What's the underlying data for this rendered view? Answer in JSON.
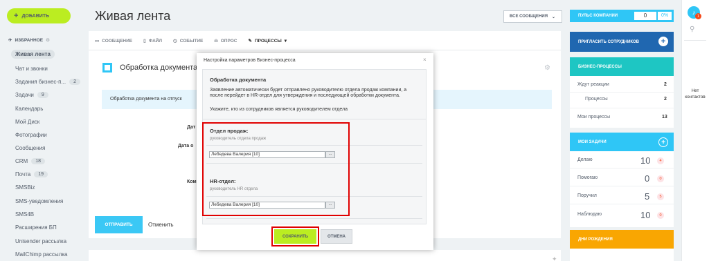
{
  "left": {
    "add_button": "ДОБАВИТЬ",
    "favorites": "ИЗБРАННОЕ",
    "items": [
      {
        "label": "Живая лента"
      },
      {
        "label": "Чат и звонки"
      },
      {
        "label": "Задания бизнес-п...",
        "count": "2"
      },
      {
        "label": "Задачи",
        "count": "9"
      },
      {
        "label": "Календарь"
      },
      {
        "label": "Мой Диск"
      },
      {
        "label": "Фотографии"
      },
      {
        "label": "Сообщения"
      },
      {
        "label": "CRM",
        "count": "18"
      },
      {
        "label": "Почта",
        "count": "19"
      },
      {
        "label": "SMSBiz"
      },
      {
        "label": "SMS-уведомления"
      },
      {
        "label": "SMS4B"
      },
      {
        "label": "Расширения БП"
      },
      {
        "label": "Unisender рассылка"
      },
      {
        "label": "MailChimp рассылка"
      }
    ]
  },
  "header": {
    "title": "Живая лента",
    "filter": "ВСЕ СООБЩЕНИЯ"
  },
  "composer": {
    "tabs": [
      "СООБЩЕНИЕ",
      "ФАЙЛ",
      "СОБЫТИЕ",
      "ОПРОС",
      "ПРОЦЕССЫ"
    ],
    "doc_title": "Обработка документа",
    "info": "Обработка документа на отпуск",
    "field_labels": [
      "Дат",
      "Дата о",
      "Ком"
    ],
    "send": "ОТПРАВИТЬ",
    "cancel": "Отменить"
  },
  "dialog": {
    "title": "Настройка параметров Бизнес-процесса",
    "name": "Обработка документа",
    "description": "Заявление автоматически будет отправлено руководителю отдела продаж компании, а после перейдет в HR-отдел для утверждения и последующей обработки документа.",
    "ask": "Укажите, кто из сотрудников является руководителем отдела",
    "sections": [
      {
        "title": "Отдел продаж:",
        "sub": "руководитель отдела продаж",
        "value": "Лебедева Валерия [10]"
      },
      {
        "title": "HR-отдел:",
        "sub": "руководитель HR отдела",
        "value": "Лебедева Валерия [10]"
      }
    ],
    "dots": "...",
    "save": "СОХРАНИТЬ",
    "cancel": "ОТМЕНА"
  },
  "right": {
    "pulse": {
      "label": "ПУЛЬС КОМПАНИИ",
      "value": "0",
      "percent": "0%"
    },
    "invite": "ПРИГЛАСИТЬ СОТРУДНИКОВ",
    "bp": {
      "title": "БИЗНЕС-ПРОЦЕССЫ",
      "rows": [
        {
          "label": "Ждут реакции",
          "value": "2"
        },
        {
          "label": "Процессы",
          "value": "2"
        },
        {
          "label": "Мои процессы",
          "value": "13"
        }
      ]
    },
    "tasks": {
      "title": "МОИ ЗАДАЧИ",
      "rows": [
        {
          "label": "Делаю",
          "value": "10",
          "badge": "4"
        },
        {
          "label": "Помогаю",
          "value": "0",
          "badge": "0"
        },
        {
          "label": "Поручил",
          "value": "5",
          "badge": "5"
        },
        {
          "label": "Наблюдаю",
          "value": "10",
          "badge": "0"
        }
      ]
    },
    "birthdays": "ДНИ РОЖДЕНИЯ"
  },
  "far": {
    "notifications": "1",
    "no_contacts": "Нет контактов"
  },
  "colors": {
    "accent": "#2fc6f6",
    "green": "#bbed21",
    "highlight": "#e00000",
    "teal": "#1ec6c3",
    "navy": "#2067b0",
    "orange": "#f9a602"
  }
}
